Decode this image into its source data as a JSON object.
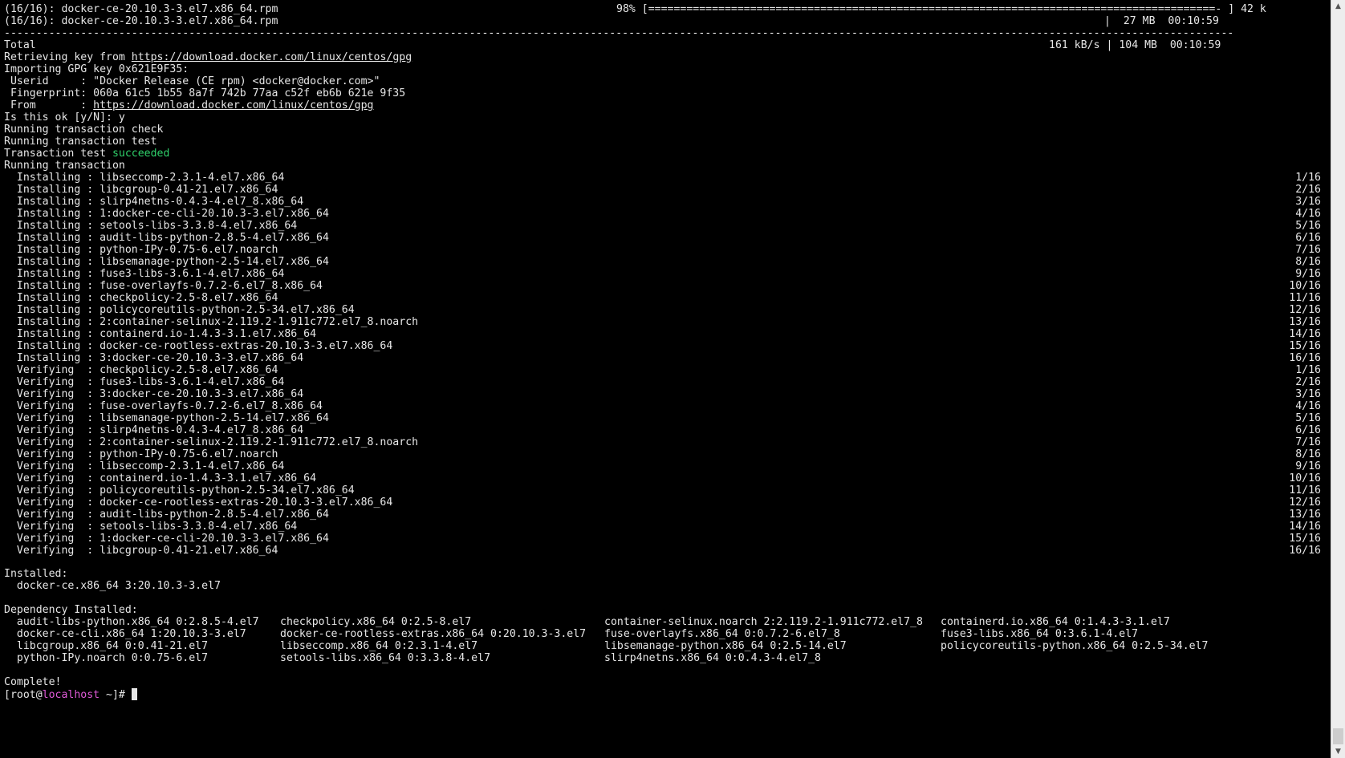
{
  "header": {
    "line1_left": "(16/16): docker-ce-20.10.3-3.el7.x86_64.rpm",
    "line1_progress": "98% [=========================================================================================- ] 42 k",
    "line2_left": "(16/16): docker-ce-20.10.3-3.el7.x86_64.rpm",
    "line2_right": "|  27 MB  00:10:59",
    "separator": "------------------------------------------------------------------------------------------------------------------------------------------------------------------------------------------------------------------"
  },
  "total": {
    "label": "Total",
    "right": "161 kB/s | 104 MB  00:10:59"
  },
  "gpg": {
    "retrieving_prefix": "Retrieving key from ",
    "retrieving_url": "https://download.docker.com/linux/centos/gpg",
    "importing": "Importing GPG key 0x621E9F35:",
    "userid": " Userid     : \"Docker Release (CE rpm) <docker@docker.com>\"",
    "fingerprint": " Fingerprint: 060a 61c5 1b55 8a7f 742b 77aa c52f eb6b 621e 9f35",
    "from_prefix": " From       : ",
    "from_url": "https://download.docker.com/linux/centos/gpg",
    "prompt": "Is this ok [y/N]: y"
  },
  "transaction": {
    "check": "Running transaction check",
    "test": "Running transaction test",
    "result_prefix": "Transaction test ",
    "result_word": "succeeded",
    "running": "Running transaction"
  },
  "steps": [
    {
      "text": "  Installing : libseccomp-2.3.1-4.el7.x86_64",
      "count": "1/16"
    },
    {
      "text": "  Installing : libcgroup-0.41-21.el7.x86_64",
      "count": "2/16"
    },
    {
      "text": "  Installing : slirp4netns-0.4.3-4.el7_8.x86_64",
      "count": "3/16"
    },
    {
      "text": "  Installing : 1:docker-ce-cli-20.10.3-3.el7.x86_64",
      "count": "4/16"
    },
    {
      "text": "  Installing : setools-libs-3.3.8-4.el7.x86_64",
      "count": "5/16"
    },
    {
      "text": "  Installing : audit-libs-python-2.8.5-4.el7.x86_64",
      "count": "6/16"
    },
    {
      "text": "  Installing : python-IPy-0.75-6.el7.noarch",
      "count": "7/16"
    },
    {
      "text": "  Installing : libsemanage-python-2.5-14.el7.x86_64",
      "count": "8/16"
    },
    {
      "text": "  Installing : fuse3-libs-3.6.1-4.el7.x86_64",
      "count": "9/16"
    },
    {
      "text": "  Installing : fuse-overlayfs-0.7.2-6.el7_8.x86_64",
      "count": "10/16"
    },
    {
      "text": "  Installing : checkpolicy-2.5-8.el7.x86_64",
      "count": "11/16"
    },
    {
      "text": "  Installing : policycoreutils-python-2.5-34.el7.x86_64",
      "count": "12/16"
    },
    {
      "text": "  Installing : 2:container-selinux-2.119.2-1.911c772.el7_8.noarch",
      "count": "13/16"
    },
    {
      "text": "  Installing : containerd.io-1.4.3-3.1.el7.x86_64",
      "count": "14/16"
    },
    {
      "text": "  Installing : docker-ce-rootless-extras-20.10.3-3.el7.x86_64",
      "count": "15/16"
    },
    {
      "text": "  Installing : 3:docker-ce-20.10.3-3.el7.x86_64",
      "count": "16/16"
    },
    {
      "text": "  Verifying  : checkpolicy-2.5-8.el7.x86_64",
      "count": "1/16"
    },
    {
      "text": "  Verifying  : fuse3-libs-3.6.1-4.el7.x86_64",
      "count": "2/16"
    },
    {
      "text": "  Verifying  : 3:docker-ce-20.10.3-3.el7.x86_64",
      "count": "3/16"
    },
    {
      "text": "  Verifying  : fuse-overlayfs-0.7.2-6.el7_8.x86_64",
      "count": "4/16"
    },
    {
      "text": "  Verifying  : libsemanage-python-2.5-14.el7.x86_64",
      "count": "5/16"
    },
    {
      "text": "  Verifying  : slirp4netns-0.4.3-4.el7_8.x86_64",
      "count": "6/16"
    },
    {
      "text": "  Verifying  : 2:container-selinux-2.119.2-1.911c772.el7_8.noarch",
      "count": "7/16"
    },
    {
      "text": "  Verifying  : python-IPy-0.75-6.el7.noarch",
      "count": "8/16"
    },
    {
      "text": "  Verifying  : libseccomp-2.3.1-4.el7.x86_64",
      "count": "9/16"
    },
    {
      "text": "  Verifying  : containerd.io-1.4.3-3.1.el7.x86_64",
      "count": "10/16"
    },
    {
      "text": "  Verifying  : policycoreutils-python-2.5-34.el7.x86_64",
      "count": "11/16"
    },
    {
      "text": "  Verifying  : docker-ce-rootless-extras-20.10.3-3.el7.x86_64",
      "count": "12/16"
    },
    {
      "text": "  Verifying  : audit-libs-python-2.8.5-4.el7.x86_64",
      "count": "13/16"
    },
    {
      "text": "  Verifying  : setools-libs-3.3.8-4.el7.x86_64",
      "count": "14/16"
    },
    {
      "text": "  Verifying  : 1:docker-ce-cli-20.10.3-3.el7.x86_64",
      "count": "15/16"
    },
    {
      "text": "  Verifying  : libcgroup-0.41-21.el7.x86_64",
      "count": "16/16"
    }
  ],
  "installed": {
    "label": "Installed:",
    "item": "  docker-ce.x86_64 3:20.10.3-3.el7"
  },
  "dependency": {
    "label": "Dependency Installed:",
    "columns": [
      [
        "  audit-libs-python.x86_64 0:2.8.5-4.el7",
        "  docker-ce-cli.x86_64 1:20.10.3-3.el7",
        "  libcgroup.x86_64 0:0.41-21.el7",
        "  python-IPy.noarch 0:0.75-6.el7"
      ],
      [
        "checkpolicy.x86_64 0:2.5-8.el7",
        "docker-ce-rootless-extras.x86_64 0:20.10.3-3.el7",
        "libseccomp.x86_64 0:2.3.1-4.el7",
        "setools-libs.x86_64 0:3.3.8-4.el7"
      ],
      [
        "container-selinux.noarch 2:2.119.2-1.911c772.el7_8",
        "fuse-overlayfs.x86_64 0:0.7.2-6.el7_8",
        "libsemanage-python.x86_64 0:2.5-14.el7",
        "slirp4netns.x86_64 0:0.4.3-4.el7_8"
      ],
      [
        "containerd.io.x86_64 0:1.4.3-3.1.el7",
        "fuse3-libs.x86_64 0:3.6.1-4.el7",
        "policycoreutils-python.x86_64 0:2.5-34.el7",
        ""
      ]
    ]
  },
  "complete": "Complete!",
  "prompt": {
    "open": "[root@",
    "host": "localhost",
    "rest": " ~]# "
  },
  "scrollbar": {
    "up_icon": "▲",
    "down_icon": "▼"
  }
}
